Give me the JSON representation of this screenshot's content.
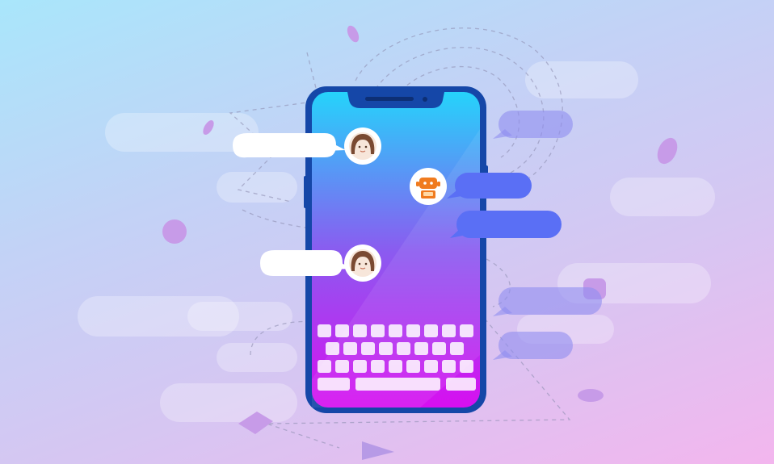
{
  "illustration": {
    "subject": "phone-chat-illustration",
    "colors": {
      "background_start": "#a9e6fb",
      "background_end": "#f3b6ee",
      "phone_frame": "#1547a8",
      "screen_top": "#25d3fb",
      "screen_bottom": "#d70ff0",
      "user_bubble": "#ffffff",
      "bot_bubble": "#5a6ff5",
      "bot_accent": "#f07b1f"
    },
    "conversation": [
      {
        "sender": "user",
        "avatar": "woman-avatar"
      },
      {
        "sender": "bot",
        "avatar": "robot-avatar"
      },
      {
        "sender": "bot",
        "avatar": "none"
      },
      {
        "sender": "user",
        "avatar": "woman-avatar"
      }
    ],
    "keyboard": {
      "row_key_counts": [
        9,
        8,
        9,
        3
      ]
    }
  }
}
